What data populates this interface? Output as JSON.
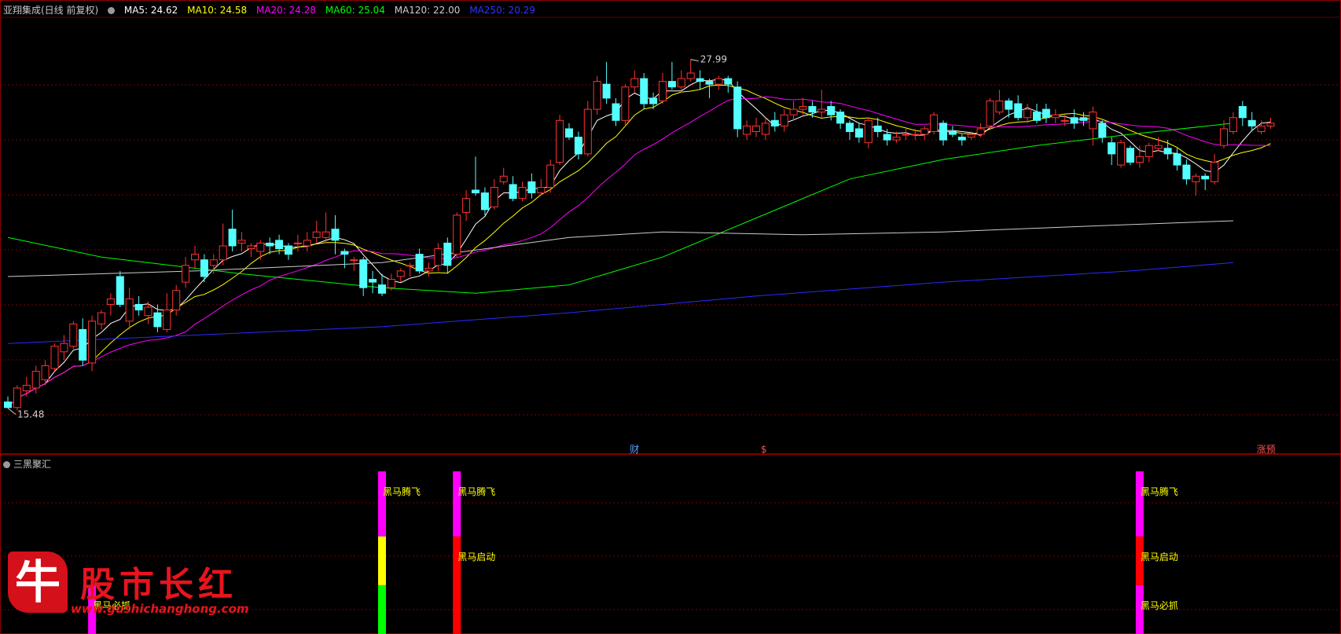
{
  "legend": {
    "title": "亚翔集成(日线 前复权)",
    "items": [
      {
        "label": "MA5: 24.62",
        "color": "#ffffff"
      },
      {
        "label": "MA10: 24.58",
        "color": "#ffff00"
      },
      {
        "label": "MA20: 24.28",
        "color": "#ff00ff"
      },
      {
        "label": "MA60: 25.04",
        "color": "#00ff00"
      },
      {
        "label": "MA120: 22.00",
        "color": "#cccccc"
      },
      {
        "label": "MA250: 20.29",
        "color": "#3333ff"
      }
    ]
  },
  "sub_panel": {
    "title": "三黑聚汇"
  },
  "logo": {
    "glyph": "牛",
    "text": "股市长红",
    "url": "www.gushichanghong.com"
  },
  "colors": {
    "up": "#ff3232",
    "down": "#54ffff",
    "grid": "#7a0000"
  },
  "chart_data": [
    {
      "type": "candlestick",
      "title": "亚翔集成(日线 前复权)",
      "ylim": [
        14,
        29.5
      ],
      "annotations": [
        {
          "label": "27.99",
          "index": 73,
          "value": 27.99,
          "kind": "high"
        },
        {
          "label": "15.48",
          "index": 0,
          "value": 15.48,
          "kind": "low"
        },
        {
          "label": "财",
          "index": 67
        },
        {
          "label": "$",
          "index": 81
        },
        {
          "label": "涨预",
          "index": 134
        }
      ],
      "candles": [
        [
          15.7,
          15.5,
          15.9,
          15.48
        ],
        [
          15.5,
          16.2,
          16.3,
          15.4
        ],
        [
          16.1,
          16.3,
          16.6,
          15.9
        ],
        [
          16.2,
          16.8,
          17.0,
          16.0
        ],
        [
          16.5,
          17.0,
          17.2,
          16.3
        ],
        [
          16.9,
          17.7,
          17.8,
          16.8
        ],
        [
          17.5,
          17.8,
          18.1,
          17.2
        ],
        [
          17.7,
          18.5,
          18.6,
          17.6
        ],
        [
          18.3,
          17.2,
          18.7,
          17.0
        ],
        [
          17.1,
          18.6,
          18.8,
          16.8
        ],
        [
          18.5,
          18.9,
          19.0,
          18.3
        ],
        [
          19.2,
          19.4,
          19.6,
          18.8
        ],
        [
          20.2,
          19.2,
          20.4,
          19.1
        ],
        [
          18.6,
          19.4,
          19.8,
          18.3
        ],
        [
          19.2,
          19.0,
          19.5,
          18.8
        ],
        [
          18.8,
          19.1,
          19.3,
          18.5
        ],
        [
          18.9,
          18.4,
          19.2,
          18.2
        ],
        [
          18.3,
          19.0,
          19.6,
          18.2
        ],
        [
          19.0,
          19.7,
          19.9,
          18.8
        ],
        [
          20.0,
          20.6,
          20.9,
          19.8
        ],
        [
          20.8,
          21.0,
          21.3,
          20.5
        ],
        [
          20.8,
          20.2,
          21.0,
          20.0
        ],
        [
          20.6,
          20.8,
          21.0,
          20.3
        ],
        [
          20.8,
          21.3,
          22.1,
          20.6
        ],
        [
          21.9,
          21.3,
          22.6,
          21.1
        ],
        [
          21.4,
          21.5,
          21.8,
          21.1
        ],
        [
          21.2,
          21.3,
          21.4,
          20.9
        ],
        [
          21.1,
          21.4,
          21.5,
          20.8
        ],
        [
          21.4,
          21.3,
          21.6,
          21.0
        ],
        [
          21.5,
          21.2,
          21.7,
          21.0
        ],
        [
          21.3,
          21.0,
          21.4,
          20.8
        ],
        [
          21.4,
          21.4,
          21.7,
          21.1
        ],
        [
          21.3,
          21.5,
          21.8,
          21.1
        ],
        [
          21.6,
          21.8,
          22.2,
          21.4
        ],
        [
          21.6,
          21.8,
          22.5,
          21.4
        ],
        [
          21.9,
          21.5,
          22.4,
          21.0
        ],
        [
          21.1,
          21.0,
          21.2,
          20.5
        ],
        [
          20.8,
          20.8,
          20.9,
          20.4
        ],
        [
          20.8,
          19.8,
          20.9,
          19.5
        ],
        [
          20.1,
          20.0,
          20.4,
          19.6
        ],
        [
          19.9,
          19.6,
          20.3,
          19.5
        ],
        [
          19.8,
          20.1,
          20.3,
          19.7
        ],
        [
          20.2,
          20.4,
          20.5,
          20.0
        ],
        [
          20.6,
          20.6,
          20.7,
          20.2
        ],
        [
          21.0,
          20.4,
          21.2,
          20.3
        ],
        [
          20.4,
          20.5,
          20.7,
          20.2
        ],
        [
          20.6,
          21.2,
          21.4,
          20.4
        ],
        [
          21.4,
          20.6,
          21.6,
          20.3
        ],
        [
          21.0,
          22.4,
          22.5,
          20.9
        ],
        [
          22.5,
          23.0,
          23.3,
          22.2
        ],
        [
          23.3,
          23.2,
          24.5,
          23.1
        ],
        [
          23.2,
          22.6,
          23.4,
          22.4
        ],
        [
          22.7,
          23.4,
          23.7,
          22.6
        ],
        [
          23.6,
          23.8,
          24.1,
          23.5
        ],
        [
          23.5,
          23.0,
          23.8,
          22.9
        ],
        [
          23.0,
          23.4,
          23.6,
          22.9
        ],
        [
          23.6,
          23.2,
          23.9,
          23.0
        ],
        [
          23.2,
          23.4,
          23.7,
          23.1
        ],
        [
          23.4,
          24.2,
          24.4,
          23.2
        ],
        [
          24.3,
          25.8,
          26.0,
          24.2
        ],
        [
          25.5,
          25.2,
          25.7,
          25.1
        ],
        [
          25.2,
          24.6,
          25.4,
          24.4
        ],
        [
          24.6,
          26.2,
          26.5,
          24.5
        ],
        [
          26.2,
          27.2,
          27.4,
          26.0
        ],
        [
          27.1,
          26.6,
          27.9,
          26.4
        ],
        [
          26.4,
          25.8,
          26.6,
          25.6
        ],
        [
          25.8,
          27.0,
          27.1,
          25.6
        ],
        [
          27.0,
          27.3,
          27.6,
          26.8
        ],
        [
          27.3,
          26.4,
          27.5,
          26.2
        ],
        [
          26.6,
          26.4,
          26.8,
          26.2
        ],
        [
          26.5,
          27.2,
          27.5,
          26.4
        ],
        [
          27.2,
          27.0,
          27.9,
          26.9
        ],
        [
          27.0,
          27.3,
          27.6,
          26.8
        ],
        [
          27.3,
          27.5,
          27.99,
          27.2
        ],
        [
          27.3,
          27.2,
          27.6,
          26.9
        ],
        [
          27.2,
          27.1,
          27.3,
          26.6
        ],
        [
          27.1,
          27.3,
          27.4,
          26.9
        ],
        [
          27.3,
          27.1,
          27.4,
          26.8
        ],
        [
          27.0,
          25.5,
          27.2,
          25.2
        ],
        [
          25.3,
          25.6,
          25.8,
          25.1
        ],
        [
          25.4,
          25.6,
          25.9,
          25.2
        ],
        [
          25.3,
          25.7,
          25.9,
          25.1
        ],
        [
          25.8,
          25.6,
          26.1,
          25.4
        ],
        [
          25.6,
          26.0,
          26.2,
          25.4
        ],
        [
          26.0,
          26.2,
          26.5,
          25.8
        ],
        [
          26.2,
          26.3,
          26.6,
          26.0
        ],
        [
          26.3,
          26.1,
          26.5,
          25.9
        ],
        [
          26.1,
          26.2,
          26.9,
          25.9
        ],
        [
          26.3,
          26.0,
          26.5,
          25.8
        ],
        [
          26.1,
          25.7,
          26.2,
          25.5
        ],
        [
          25.7,
          25.4,
          25.8,
          25.1
        ],
        [
          25.5,
          25.2,
          25.7,
          25.0
        ],
        [
          25.0,
          25.8,
          25.9,
          24.8
        ],
        [
          25.6,
          25.4,
          25.9,
          25.2
        ],
        [
          25.3,
          25.1,
          25.5,
          24.9
        ],
        [
          25.1,
          25.2,
          25.4,
          25.0
        ],
        [
          25.3,
          25.3,
          25.5,
          25.1
        ],
        [
          25.3,
          25.3,
          25.5,
          25.1
        ],
        [
          25.3,
          25.5,
          25.6,
          25.1
        ],
        [
          25.4,
          26.0,
          26.1,
          25.3
        ],
        [
          25.7,
          25.1,
          25.8,
          24.9
        ],
        [
          25.4,
          25.3,
          25.6,
          25.2
        ],
        [
          25.2,
          25.1,
          25.3,
          24.9
        ],
        [
          25.2,
          25.3,
          25.4,
          25.1
        ],
        [
          25.3,
          25.5,
          25.7,
          25.2
        ],
        [
          25.6,
          26.5,
          26.6,
          25.5
        ],
        [
          26.1,
          26.5,
          26.9,
          26.0
        ],
        [
          26.5,
          26.2,
          26.6,
          25.9
        ],
        [
          26.4,
          25.9,
          26.7,
          25.8
        ],
        [
          25.9,
          26.2,
          26.4,
          25.7
        ],
        [
          26.1,
          25.8,
          26.4,
          25.7
        ],
        [
          26.2,
          25.9,
          26.4,
          25.7
        ],
        [
          25.9,
          26.0,
          26.2,
          25.7
        ],
        [
          25.8,
          25.8,
          26.0,
          25.6
        ],
        [
          25.9,
          25.7,
          26.2,
          25.5
        ],
        [
          25.9,
          25.8,
          26.1,
          25.6
        ],
        [
          25.5,
          26.1,
          26.3,
          24.9
        ],
        [
          25.7,
          25.2,
          25.8,
          25.0
        ],
        [
          25.0,
          24.6,
          25.2,
          24.2
        ],
        [
          24.2,
          25.0,
          25.1,
          24.1
        ],
        [
          24.8,
          24.3,
          24.9,
          24.2
        ],
        [
          24.3,
          24.5,
          24.9,
          24.1
        ],
        [
          24.5,
          24.9,
          25.0,
          24.3
        ],
        [
          24.8,
          24.9,
          25.2,
          24.7
        ],
        [
          24.8,
          24.6,
          25.1,
          24.4
        ],
        [
          24.6,
          24.2,
          24.8,
          24.0
        ],
        [
          24.2,
          23.7,
          24.4,
          23.5
        ],
        [
          23.6,
          23.8,
          23.9,
          23.1
        ],
        [
          23.8,
          23.7,
          23.9,
          23.3
        ],
        [
          23.6,
          24.3,
          24.6,
          23.5
        ],
        [
          24.9,
          25.5,
          25.8,
          24.8
        ],
        [
          25.4,
          25.9,
          26.1,
          25.3
        ],
        [
          26.3,
          25.9,
          26.5,
          25.6
        ],
        [
          25.8,
          25.6,
          26.1,
          25.4
        ],
        [
          25.4,
          25.6,
          25.8,
          25.3
        ],
        [
          25.6,
          25.7,
          25.9,
          25.5
        ]
      ]
    },
    {
      "type": "bar",
      "title": "三黑聚汇",
      "signals": [
        {
          "index": 9,
          "label": "黑马必抓",
          "color": "#ff00ff",
          "from": 0.0,
          "to": 0.3
        },
        {
          "index": 40,
          "label": "黑马腾飞",
          "color": "#ff00ff",
          "from": 0.6,
          "to": 1.0
        },
        {
          "index": 40,
          "label": "",
          "color": "#ffff00",
          "from": 0.3,
          "to": 0.6
        },
        {
          "index": 40,
          "label": "",
          "color": "#00ff00",
          "from": 0.0,
          "to": 0.3
        },
        {
          "index": 48,
          "label": "黑马腾飞",
          "color": "#ff00ff",
          "from": 0.6,
          "to": 1.0
        },
        {
          "index": 48,
          "label": "黑马启动",
          "color": "#ff0000",
          "from": 0.0,
          "to": 0.6
        },
        {
          "index": 121,
          "label": "黑马腾飞",
          "color": "#ff00ff",
          "from": 0.6,
          "to": 1.0
        },
        {
          "index": 121,
          "label": "黑马启动",
          "color": "#ff0000",
          "from": 0.3,
          "to": 0.6
        },
        {
          "index": 121,
          "label": "黑马必抓",
          "color": "#ff00ff",
          "from": 0.0,
          "to": 0.3
        }
      ]
    }
  ]
}
